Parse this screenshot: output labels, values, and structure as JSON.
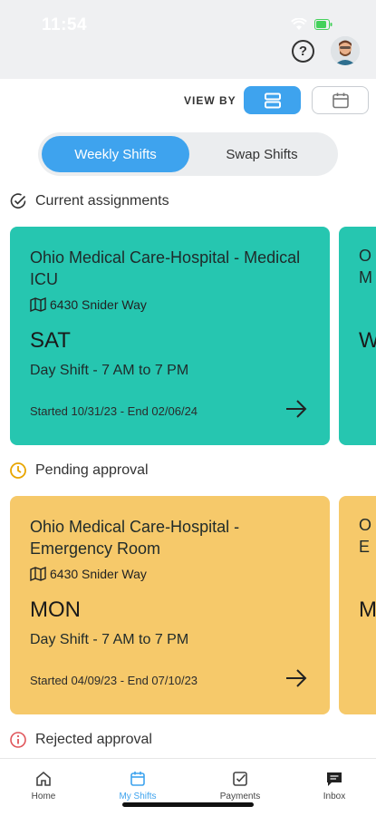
{
  "status_bar": {
    "time": "11:54",
    "icons": [
      "wifi-icon",
      "battery-icon"
    ]
  },
  "header": {
    "help_icon": "question-circle-icon",
    "avatar_icon": "user-avatar"
  },
  "view_by": {
    "label": "VIEW BY",
    "options": [
      "list-view-icon",
      "calendar-icon"
    ],
    "selected": "list-view-icon"
  },
  "tabs": {
    "items": [
      "Weekly Shifts",
      "Swap Shifts"
    ],
    "active": "Weekly Shifts"
  },
  "sections": {
    "current": "Current assignments",
    "pending": "Pending approval",
    "rejected": "Rejected approval"
  },
  "cards": [
    {
      "facility": "Ohio Medical Care-Hospital - Medical ICU",
      "address": "6430 Snider Way",
      "day": "SAT",
      "shift": "Day Shift - 7 AM to 7 PM",
      "dates": "Started 10/31/23 - End 02/06/24",
      "color": "#26c6b0"
    },
    {
      "facility": "Ohio Medical Care-Hospital - Emergency Room",
      "address": "6430 Snider Way",
      "day": "MON",
      "shift": "Day Shift - 7 AM to 7 PM",
      "dates": "Started 04/09/23 - End 07/10/23",
      "color": "#f6c96a"
    }
  ],
  "peek_cards": [
    {
      "letters": [
        "O",
        "M",
        "W"
      ]
    },
    {
      "letters": [
        "O",
        "E",
        "M"
      ]
    }
  ],
  "nav": {
    "items": [
      "Home",
      "My Shifts",
      "Payments",
      "Inbox"
    ],
    "active": "My Shifts"
  },
  "colors": {
    "accent": "#3ea3ee",
    "teal": "#26c6b0",
    "yellow": "#f6c96a",
    "pending_icon": "#e8a500",
    "rejected_icon": "#e0555a"
  }
}
